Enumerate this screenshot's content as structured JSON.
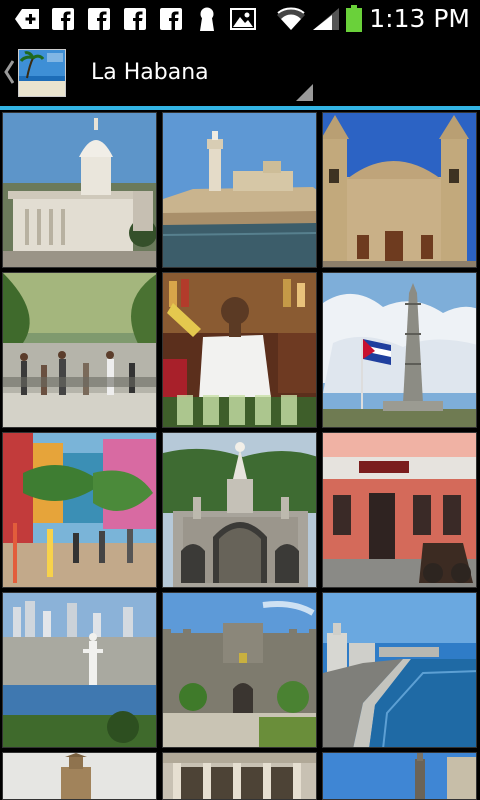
{
  "status_bar": {
    "time": "1:13 PM",
    "icons": [
      "add-icon",
      "facebook-icon",
      "facebook-icon",
      "facebook-icon",
      "facebook-icon",
      "keyhole-icon",
      "image-icon",
      "wifi-icon",
      "signal-icon",
      "battery-icon"
    ]
  },
  "action_bar": {
    "title": "La Habana",
    "accent_color": "#33b5e5"
  },
  "gallery": {
    "photos": [
      {
        "subject": "capitolio"
      },
      {
        "subject": "morro-castle"
      },
      {
        "subject": "cathedral"
      },
      {
        "subject": "prado-promenade"
      },
      {
        "subject": "bartender-mojitos"
      },
      {
        "subject": "jose-marti-memorial"
      },
      {
        "subject": "callejon-de-hamel"
      },
      {
        "subject": "colon-cemetery-gate"
      },
      {
        "subject": "floridita-bar"
      },
      {
        "subject": "skyline-christ"
      },
      {
        "subject": "la-cabana-fortress"
      },
      {
        "subject": "malecon"
      },
      {
        "subject": "statue-column"
      },
      {
        "subject": "colonnade"
      },
      {
        "subject": "tower-sky"
      }
    ]
  }
}
